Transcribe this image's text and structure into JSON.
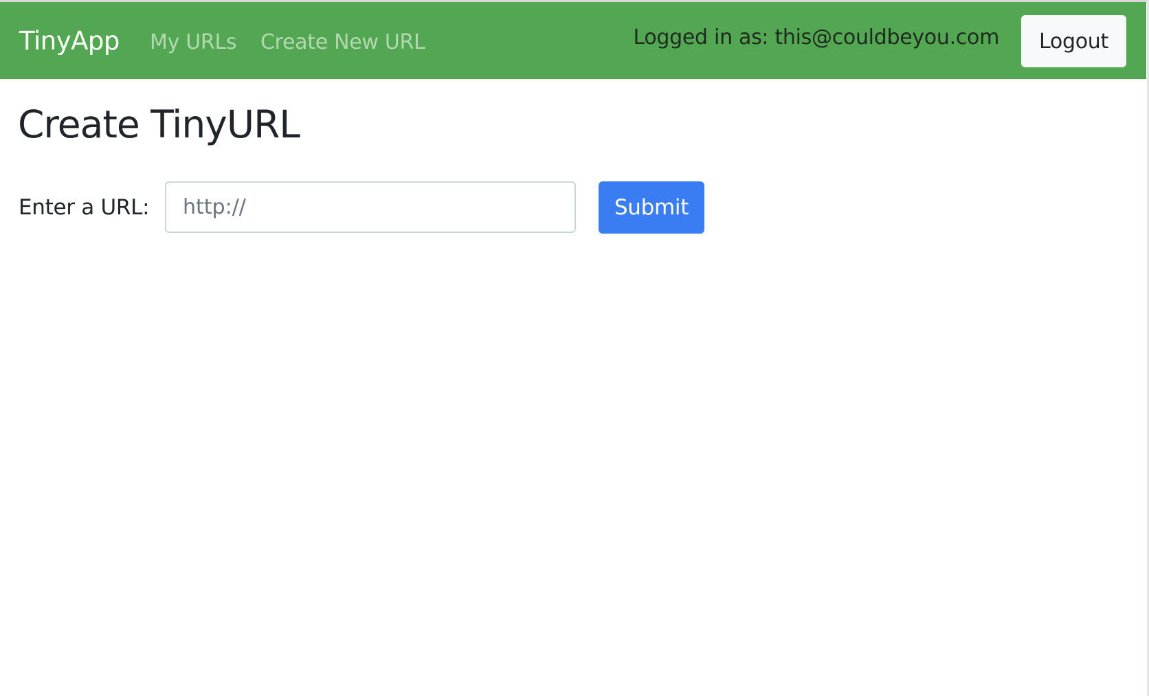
{
  "navbar": {
    "brand": "TinyApp",
    "links": [
      {
        "label": "My URLs"
      },
      {
        "label": "Create New URL"
      }
    ],
    "logged_in_text": "Logged in as: this@couldbeyou.com",
    "logout_label": "Logout"
  },
  "main": {
    "title": "Create TinyURL",
    "form": {
      "url_label": "Enter a URL:",
      "url_value": "",
      "url_placeholder": "http://",
      "submit_label": "Submit"
    }
  },
  "colors": {
    "navbar_bg": "#54a752",
    "primary_button": "#3a7cf1",
    "light_button": "#f8f9fa",
    "text": "#212529"
  }
}
